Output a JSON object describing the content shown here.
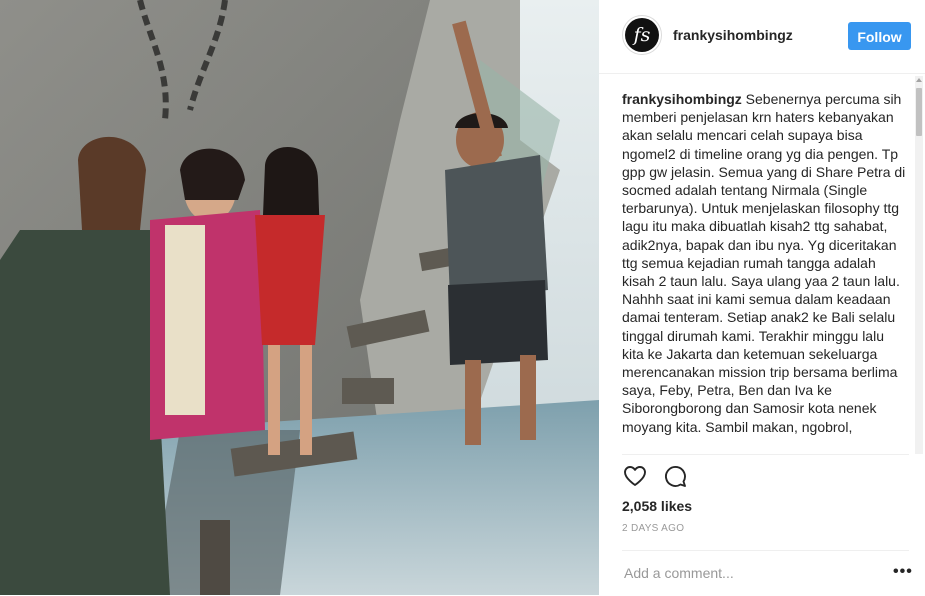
{
  "post": {
    "username": "frankysihombingz",
    "avatar_initials": "fs",
    "follow_label": "Follow",
    "caption_username": "frankysihombingz",
    "caption_text": " Sebenernya percuma sih memberi penjelasan krn haters kebanyakan akan selalu mencari celah supaya bisa ngomel2 di timeline orang yg dia pengen. Tp gpp gw jelasin. Semua yang di Share Petra di socmed adalah tentang Nirmala (Single terbarunya). Untuk menjelaskan filosophy ttg lagu itu maka dibuatlah kisah2 ttg sahabat, adik2nya, bapak dan ibu nya. Yg diceritakan ttg semua kejadian rumah tangga adalah kisah 2 taun lalu. Saya ulang yaa 2 taun lalu. Nahhh saat ini kami semua dalam keadaan damai tenteram. Setiap anak2 ke Bali selalu tinggal dirumah kami. Terakhir minggu lalu kita ke Jakarta dan ketemuan sekeluarga merencanakan mission trip bersama berlima saya, Feby, Petra, Ben dan Iva ke Siborongborong dan Samosir kota nenek moyang kita. Sambil makan, ngobrol,",
    "likes": "2,058 likes",
    "time": "2 DAYS AGO",
    "comment_placeholder": "Add a comment...",
    "more_label": "•••"
  },
  "icons": {
    "like": "heart-icon",
    "comment": "comment-bubble-icon",
    "more": "more-options-icon"
  },
  "colors": {
    "follow_button": "#3897f0",
    "text": "#262626",
    "muted": "#999999",
    "border": "#efefef"
  }
}
